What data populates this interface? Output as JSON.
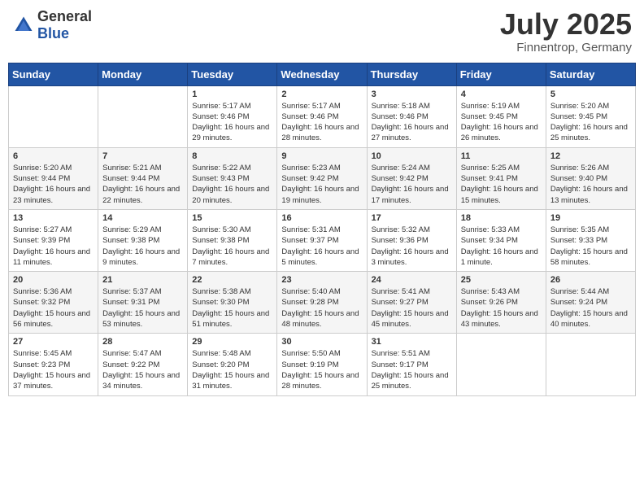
{
  "header": {
    "logo": {
      "general": "General",
      "blue": "Blue"
    },
    "title": "July 2025",
    "location": "Finnentrop, Germany"
  },
  "weekdays": [
    "Sunday",
    "Monday",
    "Tuesday",
    "Wednesday",
    "Thursday",
    "Friday",
    "Saturday"
  ],
  "weeks": [
    [
      {
        "day": null,
        "sunrise": null,
        "sunset": null,
        "daylight": null
      },
      {
        "day": null,
        "sunrise": null,
        "sunset": null,
        "daylight": null
      },
      {
        "day": "1",
        "sunrise": "Sunrise: 5:17 AM",
        "sunset": "Sunset: 9:46 PM",
        "daylight": "Daylight: 16 hours and 29 minutes."
      },
      {
        "day": "2",
        "sunrise": "Sunrise: 5:17 AM",
        "sunset": "Sunset: 9:46 PM",
        "daylight": "Daylight: 16 hours and 28 minutes."
      },
      {
        "day": "3",
        "sunrise": "Sunrise: 5:18 AM",
        "sunset": "Sunset: 9:46 PM",
        "daylight": "Daylight: 16 hours and 27 minutes."
      },
      {
        "day": "4",
        "sunrise": "Sunrise: 5:19 AM",
        "sunset": "Sunset: 9:45 PM",
        "daylight": "Daylight: 16 hours and 26 minutes."
      },
      {
        "day": "5",
        "sunrise": "Sunrise: 5:20 AM",
        "sunset": "Sunset: 9:45 PM",
        "daylight": "Daylight: 16 hours and 25 minutes."
      }
    ],
    [
      {
        "day": "6",
        "sunrise": "Sunrise: 5:20 AM",
        "sunset": "Sunset: 9:44 PM",
        "daylight": "Daylight: 16 hours and 23 minutes."
      },
      {
        "day": "7",
        "sunrise": "Sunrise: 5:21 AM",
        "sunset": "Sunset: 9:44 PM",
        "daylight": "Daylight: 16 hours and 22 minutes."
      },
      {
        "day": "8",
        "sunrise": "Sunrise: 5:22 AM",
        "sunset": "Sunset: 9:43 PM",
        "daylight": "Daylight: 16 hours and 20 minutes."
      },
      {
        "day": "9",
        "sunrise": "Sunrise: 5:23 AM",
        "sunset": "Sunset: 9:42 PM",
        "daylight": "Daylight: 16 hours and 19 minutes."
      },
      {
        "day": "10",
        "sunrise": "Sunrise: 5:24 AM",
        "sunset": "Sunset: 9:42 PM",
        "daylight": "Daylight: 16 hours and 17 minutes."
      },
      {
        "day": "11",
        "sunrise": "Sunrise: 5:25 AM",
        "sunset": "Sunset: 9:41 PM",
        "daylight": "Daylight: 16 hours and 15 minutes."
      },
      {
        "day": "12",
        "sunrise": "Sunrise: 5:26 AM",
        "sunset": "Sunset: 9:40 PM",
        "daylight": "Daylight: 16 hours and 13 minutes."
      }
    ],
    [
      {
        "day": "13",
        "sunrise": "Sunrise: 5:27 AM",
        "sunset": "Sunset: 9:39 PM",
        "daylight": "Daylight: 16 hours and 11 minutes."
      },
      {
        "day": "14",
        "sunrise": "Sunrise: 5:29 AM",
        "sunset": "Sunset: 9:38 PM",
        "daylight": "Daylight: 16 hours and 9 minutes."
      },
      {
        "day": "15",
        "sunrise": "Sunrise: 5:30 AM",
        "sunset": "Sunset: 9:38 PM",
        "daylight": "Daylight: 16 hours and 7 minutes."
      },
      {
        "day": "16",
        "sunrise": "Sunrise: 5:31 AM",
        "sunset": "Sunset: 9:37 PM",
        "daylight": "Daylight: 16 hours and 5 minutes."
      },
      {
        "day": "17",
        "sunrise": "Sunrise: 5:32 AM",
        "sunset": "Sunset: 9:36 PM",
        "daylight": "Daylight: 16 hours and 3 minutes."
      },
      {
        "day": "18",
        "sunrise": "Sunrise: 5:33 AM",
        "sunset": "Sunset: 9:34 PM",
        "daylight": "Daylight: 16 hours and 1 minute."
      },
      {
        "day": "19",
        "sunrise": "Sunrise: 5:35 AM",
        "sunset": "Sunset: 9:33 PM",
        "daylight": "Daylight: 15 hours and 58 minutes."
      }
    ],
    [
      {
        "day": "20",
        "sunrise": "Sunrise: 5:36 AM",
        "sunset": "Sunset: 9:32 PM",
        "daylight": "Daylight: 15 hours and 56 minutes."
      },
      {
        "day": "21",
        "sunrise": "Sunrise: 5:37 AM",
        "sunset": "Sunset: 9:31 PM",
        "daylight": "Daylight: 15 hours and 53 minutes."
      },
      {
        "day": "22",
        "sunrise": "Sunrise: 5:38 AM",
        "sunset": "Sunset: 9:30 PM",
        "daylight": "Daylight: 15 hours and 51 minutes."
      },
      {
        "day": "23",
        "sunrise": "Sunrise: 5:40 AM",
        "sunset": "Sunset: 9:28 PM",
        "daylight": "Daylight: 15 hours and 48 minutes."
      },
      {
        "day": "24",
        "sunrise": "Sunrise: 5:41 AM",
        "sunset": "Sunset: 9:27 PM",
        "daylight": "Daylight: 15 hours and 45 minutes."
      },
      {
        "day": "25",
        "sunrise": "Sunrise: 5:43 AM",
        "sunset": "Sunset: 9:26 PM",
        "daylight": "Daylight: 15 hours and 43 minutes."
      },
      {
        "day": "26",
        "sunrise": "Sunrise: 5:44 AM",
        "sunset": "Sunset: 9:24 PM",
        "daylight": "Daylight: 15 hours and 40 minutes."
      }
    ],
    [
      {
        "day": "27",
        "sunrise": "Sunrise: 5:45 AM",
        "sunset": "Sunset: 9:23 PM",
        "daylight": "Daylight: 15 hours and 37 minutes."
      },
      {
        "day": "28",
        "sunrise": "Sunrise: 5:47 AM",
        "sunset": "Sunset: 9:22 PM",
        "daylight": "Daylight: 15 hours and 34 minutes."
      },
      {
        "day": "29",
        "sunrise": "Sunrise: 5:48 AM",
        "sunset": "Sunset: 9:20 PM",
        "daylight": "Daylight: 15 hours and 31 minutes."
      },
      {
        "day": "30",
        "sunrise": "Sunrise: 5:50 AM",
        "sunset": "Sunset: 9:19 PM",
        "daylight": "Daylight: 15 hours and 28 minutes."
      },
      {
        "day": "31",
        "sunrise": "Sunrise: 5:51 AM",
        "sunset": "Sunset: 9:17 PM",
        "daylight": "Daylight: 15 hours and 25 minutes."
      },
      {
        "day": null,
        "sunrise": null,
        "sunset": null,
        "daylight": null
      },
      {
        "day": null,
        "sunrise": null,
        "sunset": null,
        "daylight": null
      }
    ]
  ]
}
